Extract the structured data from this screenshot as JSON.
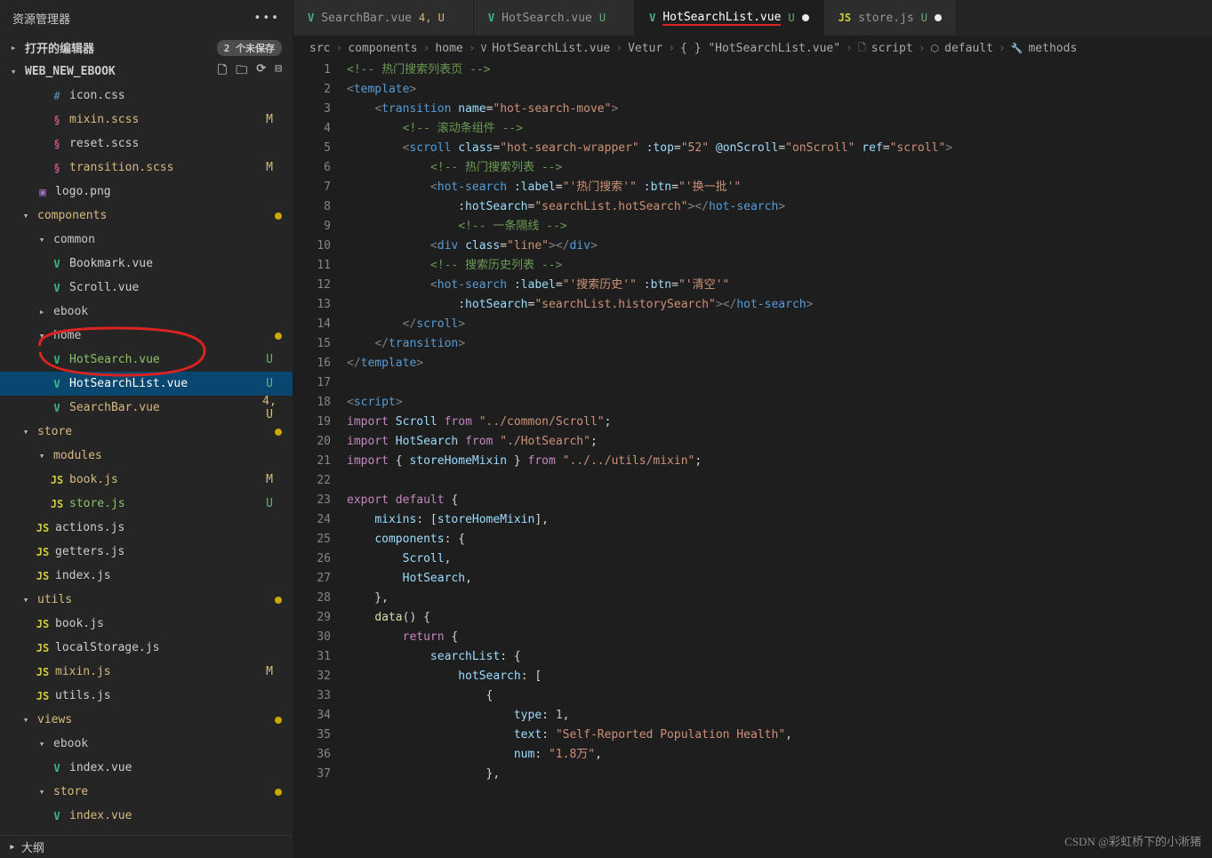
{
  "explorer": {
    "title": "资源管理器",
    "open_editors_label": "打开的编辑器",
    "open_editors_badge": "2 个未保存",
    "project": "WEB_NEW_EBOOK",
    "outline": "大纲",
    "actions": [
      "new-file",
      "new-folder",
      "refresh",
      "collapse"
    ],
    "tree": [
      {
        "icon": "css",
        "label": "icon.css",
        "indent": 3,
        "status": ""
      },
      {
        "icon": "scss",
        "label": "mixin.scss",
        "indent": 3,
        "status": "M",
        "color": "yellowish"
      },
      {
        "icon": "scss",
        "label": "reset.scss",
        "indent": 3,
        "status": ""
      },
      {
        "icon": "scss",
        "label": "transition.scss",
        "indent": 3,
        "status": "M",
        "color": "yellowish"
      },
      {
        "icon": "img",
        "label": "logo.png",
        "indent": 2,
        "status": ""
      },
      {
        "chev": "▾",
        "label": "components",
        "indent": 1,
        "folder": true,
        "color": "yellowish",
        "dot": true
      },
      {
        "chev": "▾",
        "label": "common",
        "indent": 2,
        "folder": true
      },
      {
        "icon": "vue",
        "label": "Bookmark.vue",
        "indent": 3
      },
      {
        "icon": "vue",
        "label": "Scroll.vue",
        "indent": 3
      },
      {
        "chev": "▸",
        "label": "ebook",
        "indent": 2,
        "folder": true
      },
      {
        "chev": "▾",
        "label": "home",
        "indent": 2,
        "folder": true,
        "dot": true,
        "circled": true
      },
      {
        "icon": "vue",
        "label": "HotSearch.vue",
        "indent": 3,
        "status": "U",
        "color": "greenish",
        "circled": true
      },
      {
        "icon": "vue",
        "label": "HotSearchList.vue",
        "indent": 3,
        "status": "U",
        "active": true
      },
      {
        "icon": "vue",
        "label": "SearchBar.vue",
        "indent": 3,
        "status": "4, U",
        "color": "yellowish"
      },
      {
        "chev": "▾",
        "label": "store",
        "indent": 1,
        "folder": true,
        "color": "yellowish",
        "dot": true
      },
      {
        "chev": "▾",
        "label": "modules",
        "indent": 2,
        "folder": true,
        "color": "yellowish"
      },
      {
        "icon": "js",
        "label": "book.js",
        "indent": 3,
        "status": "M",
        "color": "yellowish"
      },
      {
        "icon": "js",
        "label": "store.js",
        "indent": 3,
        "status": "U",
        "color": "greenish"
      },
      {
        "icon": "js",
        "label": "actions.js",
        "indent": 2
      },
      {
        "icon": "js",
        "label": "getters.js",
        "indent": 2
      },
      {
        "icon": "js",
        "label": "index.js",
        "indent": 2
      },
      {
        "chev": "▾",
        "label": "utils",
        "indent": 1,
        "folder": true,
        "color": "yellowish",
        "dot": true
      },
      {
        "icon": "js",
        "label": "book.js",
        "indent": 2
      },
      {
        "icon": "js",
        "label": "localStorage.js",
        "indent": 2
      },
      {
        "icon": "js",
        "label": "mixin.js",
        "indent": 2,
        "status": "M",
        "color": "yellowish"
      },
      {
        "icon": "js",
        "label": "utils.js",
        "indent": 2
      },
      {
        "chev": "▾",
        "label": "views",
        "indent": 1,
        "folder": true,
        "color": "yellowish",
        "dot": true
      },
      {
        "chev": "▾",
        "label": "ebook",
        "indent": 2,
        "folder": true
      },
      {
        "icon": "vue",
        "label": "index.vue",
        "indent": 3
      },
      {
        "chev": "▾",
        "label": "store",
        "indent": 2,
        "folder": true,
        "color": "yellowish",
        "dot": true
      },
      {
        "icon": "vue",
        "label": "index.vue",
        "indent": 3,
        "color": "yellowish"
      }
    ]
  },
  "tabs": [
    {
      "icon": "vue",
      "label": "SearchBar.vue",
      "mod": "4, U",
      "modClass": "FU",
      "dirty": false
    },
    {
      "icon": "vue",
      "label": "HotSearch.vue",
      "mod": "U",
      "modClass": "U",
      "dirty": false
    },
    {
      "icon": "vue",
      "label": "HotSearchList.vue",
      "mod": "U",
      "modClass": "U",
      "dirty": true,
      "active": true,
      "underline": true
    },
    {
      "icon": "js",
      "label": "store.js",
      "mod": "U",
      "modClass": "U",
      "dirty": true
    }
  ],
  "breadcrumb": [
    "src",
    "components",
    "home",
    "HotSearchList.vue",
    "Vetur",
    "{ }  \"HotSearchList.vue\"",
    "script",
    "default",
    "methods"
  ],
  "bc_icons": [
    "",
    "",
    "",
    "V",
    "",
    "",
    "🗋",
    "⬡",
    "🔧"
  ],
  "code_lines": [
    "<span class='c-com'>&lt;!-- 热门搜索列表页 --&gt;</span>",
    "<span class='c-pun'>&lt;</span><span class='c-tag'>template</span><span class='c-pun'>&gt;</span>",
    "    <span class='c-pun'>&lt;</span><span class='c-tag'>transition</span> <span class='c-attr'>name</span>=<span class='c-str'>\"hot-search-move\"</span><span class='c-pun'>&gt;</span>",
    "        <span class='c-com'>&lt;!-- 滚动条组件 --&gt;</span>",
    "        <span class='c-pun'>&lt;</span><span class='c-tag'>scroll</span> <span class='c-attr'>class</span>=<span class='c-str'>\"hot-search-wrapper\"</span> <span class='c-attr'>:top</span>=<span class='c-str'>\"52\"</span> <span class='c-attr'>@onScroll</span>=<span class='c-str'>\"onScroll\"</span> <span class='c-attr'>ref</span>=<span class='c-str'>\"scroll\"</span><span class='c-pun'>&gt;</span>",
    "            <span class='c-com'>&lt;!-- 热门搜索列表 --&gt;</span>",
    "            <span class='c-pun'>&lt;</span><span class='c-tag'>hot-search</span> <span class='c-attr'>:label</span>=<span class='c-str'>\"'热门搜索'\"</span> <span class='c-attr'>:btn</span>=<span class='c-str'>\"'换一批'\"</span>",
    "                <span class='c-attr'>:hotSearch</span>=<span class='c-str'>\"searchList.hotSearch\"</span><span class='c-pun'>&gt;&lt;/</span><span class='c-tag'>hot-search</span><span class='c-pun'>&gt;</span>",
    "                <span class='c-com'>&lt;!-- 一条隔线 --&gt;</span>",
    "            <span class='c-pun'>&lt;</span><span class='c-tag'>div</span> <span class='c-attr'>class</span>=<span class='c-str'>\"line\"</span><span class='c-pun'>&gt;&lt;/</span><span class='c-tag'>div</span><span class='c-pun'>&gt;</span>",
    "            <span class='c-com'>&lt;!-- 搜索历史列表 --&gt;</span>",
    "            <span class='c-pun'>&lt;</span><span class='c-tag'>hot-search</span> <span class='c-attr'>:label</span>=<span class='c-str'>\"'搜索历史'\"</span> <span class='c-attr'>:btn</span>=<span class='c-str'>\"'清空'\"</span>",
    "                <span class='c-attr'>:hotSearch</span>=<span class='c-str'>\"searchList.historySearch\"</span><span class='c-pun'>&gt;&lt;/</span><span class='c-tag'>hot-search</span><span class='c-pun'>&gt;</span>",
    "        <span class='c-pun'>&lt;/</span><span class='c-tag'>scroll</span><span class='c-pun'>&gt;</span>",
    "    <span class='c-pun'>&lt;/</span><span class='c-tag'>transition</span><span class='c-pun'>&gt;</span>",
    "<span class='c-pun'>&lt;/</span><span class='c-tag'>template</span><span class='c-pun'>&gt;</span>",
    "",
    "<span class='c-pun'>&lt;</span><span class='c-tag'>script</span><span class='c-pun'>&gt;</span>",
    "<span class='c-kw'>import</span> <span class='c-prop'>Scroll</span> <span class='c-kw'>from</span> <span class='c-str'>\"../common/Scroll\"</span>;",
    "<span class='c-kw'>import</span> <span class='c-prop'>HotSearch</span> <span class='c-kw'>from</span> <span class='c-str'>\"./HotSearch\"</span>;",
    "<span class='c-kw'>import</span> { <span class='c-prop'>storeHomeMixin</span> } <span class='c-kw'>from</span> <span class='c-str'>\"../../utils/mixin\"</span>;",
    "",
    "<span class='c-kw'>export</span> <span class='c-kw'>default</span> {",
    "    <span class='c-prop'>mixins</span>: [<span class='c-prop'>storeHomeMixin</span>],",
    "    <span class='c-prop'>components</span>: {",
    "        <span class='c-prop'>Scroll</span>,",
    "        <span class='c-prop'>HotSearch</span>,",
    "    },",
    "    <span class='c-fn'>data</span>() {",
    "        <span class='c-kw'>return</span> {",
    "            <span class='c-prop'>searchList</span>: {",
    "                <span class='c-prop'>hotSearch</span>: [",
    "                    {",
    "                        <span class='c-prop'>type</span>: <span class='c-num'>1</span>,",
    "                        <span class='c-prop'>text</span>: <span class='c-str'>\"Self-Reported Population Health\"</span>,",
    "                        <span class='c-prop'>num</span>: <span class='c-str'>\"1.8万\"</span>,",
    "                    },"
  ],
  "watermark": "CSDN @彩虹桥下的小淅猪"
}
